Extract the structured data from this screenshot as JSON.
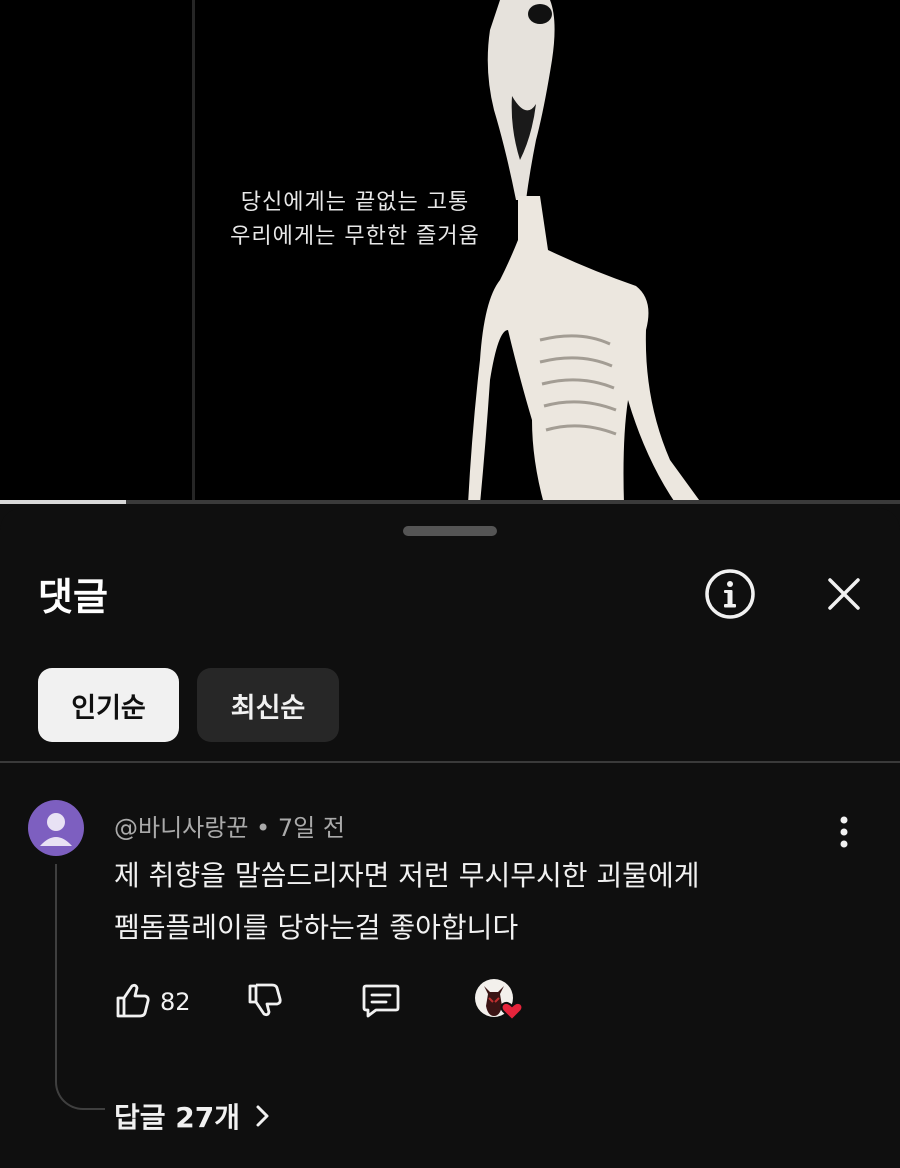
{
  "video": {
    "subtitle_line1": "당신에게는 끝없는 고통",
    "subtitle_line2": "우리에게는 무한한 즐거움",
    "progress": 0.14
  },
  "comments_panel": {
    "title": "댓글",
    "info_icon": "info-icon",
    "close_icon": "close-icon",
    "sort_chips": [
      {
        "label": "인기순",
        "selected": true
      },
      {
        "label": "최신순",
        "selected": false
      }
    ]
  },
  "comment": {
    "author": "@바니사랑꾼",
    "time": "7일 전",
    "text_line1": "제 취향을 말씀드리자면 저런 무시무시한 괴물에게",
    "text_line2": "펨돔플레이를 당하는걸 좋아합니다",
    "like_count": "82",
    "replies_label": "답글 27개",
    "avatar_color": "#7d5fc0",
    "heart_color": "#e5243b"
  }
}
